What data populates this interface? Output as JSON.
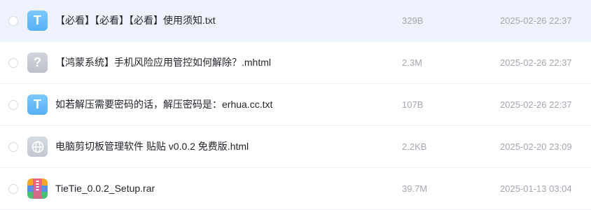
{
  "files": [
    {
      "name": "【必看】【必看】【必看】使用须知.txt",
      "size": "329B",
      "date": "2025-02-26 22:37",
      "icon": "txt-file-icon",
      "icon_glyph": "T",
      "highlighted": true
    },
    {
      "name": "【鸿蒙系统】手机风险应用管控如何解除？.mhtml",
      "size": "2.3M",
      "date": "2025-02-26 22:37",
      "icon": "unknown-file-icon",
      "icon_glyph": "?"
    },
    {
      "name": "如若解压需要密码的话，解压密码是：erhua.cc.txt",
      "size": "107B",
      "date": "2025-02-26 22:37",
      "icon": "txt-file-icon",
      "icon_glyph": "T"
    },
    {
      "name": "电脑剪切板管理软件 贴贴 v0.0.2 免费版.html",
      "size": "2.2KB",
      "date": "2025-02-20 23:09",
      "icon": "html-file-icon"
    },
    {
      "name": "TieTie_0.0.2_Setup.rar",
      "size": "39.7M",
      "date": "2025-01-13 03:04",
      "icon": "archive-file-icon"
    }
  ],
  "colors": {
    "highlight_row": "#eef2fd",
    "txt_icon": "#6cbcfb",
    "unknown_icon": "#c6cad3",
    "meta_text": "#a3a8b1"
  }
}
